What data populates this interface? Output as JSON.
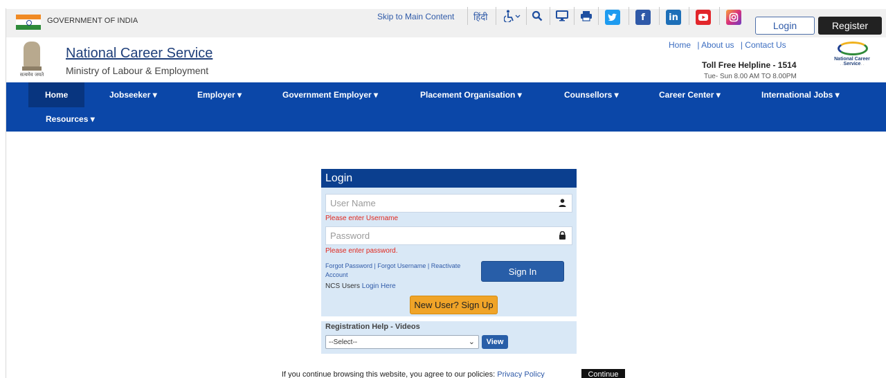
{
  "gov_bar": {
    "label": "GOVERNMENT OF INDIA",
    "skip_link": "Skip to Main Content",
    "hindi": "हिंदी",
    "icons": [
      "accessibility-icon",
      "search-icon",
      "monitor-icon",
      "print-icon"
    ],
    "social": [
      "twitter-icon",
      "facebook-icon",
      "linkedin-icon",
      "youtube-icon",
      "instagram-icon"
    ],
    "login": "Login",
    "register": "Register"
  },
  "header": {
    "emblem_motto": "सत्यमेव जयते",
    "title": "National Career Service",
    "subtitle": "Ministry of Labour & Employment",
    "links": [
      "Home",
      "| About us",
      "| Contact Us"
    ],
    "helpline": "Toll Free Helpline - 1514",
    "helpline_hours": "Tue- Sun 8.00 AM TO 8.00PM",
    "logo_caption": "National Career Service"
  },
  "nav": {
    "items": [
      "Home",
      "Jobseeker ▾",
      "Employer ▾",
      "Government Employer ▾",
      "Placement Organisation ▾",
      "Counsellors ▾",
      "Career Center ▾",
      "International Jobs ▾",
      "Resources ▾"
    ],
    "active": "Home",
    "color": "#0b47a8"
  },
  "login": {
    "heading": "Login",
    "username_placeholder": "User Name",
    "username_error": "Please enter Username",
    "password_placeholder": "Password",
    "password_error": "Please enter password.",
    "forgot_links": "Forgot Password | Forgot Username | Reactivate Account",
    "ncs_users_prefix": "NCS Users",
    "ncs_users_link": "Login Here",
    "signin": "Sign In",
    "new_user": "New User? Sign Up"
  },
  "registration_help": {
    "title": "Registration Help - Videos",
    "selected": "--Select--",
    "view": "View"
  },
  "cookie": {
    "text": "If you continue browsing this website, you agree to our policies:",
    "policy_link": "Privacy Policy",
    "continue": "Continue"
  }
}
